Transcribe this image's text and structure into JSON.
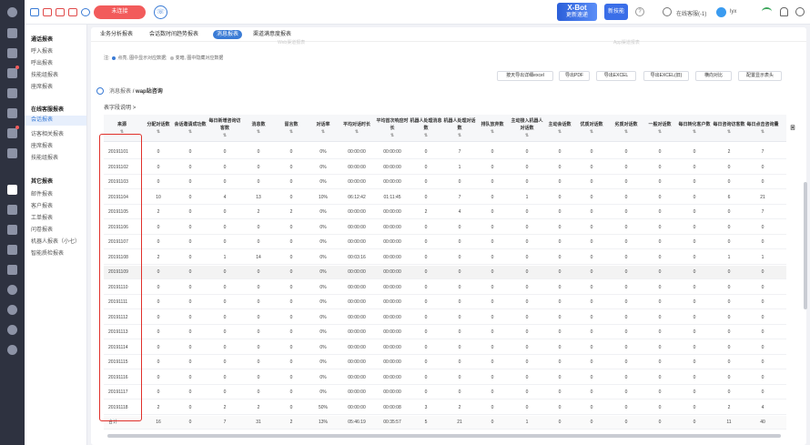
{
  "topbar": {
    "status_label": "未连接",
    "xbot_title": "X-Bot",
    "xbot_sub": "更新速递",
    "new_skill": "新技能",
    "help": "?",
    "online": "在线客服(-1)",
    "user": "lyx"
  },
  "menu": {
    "groups": [
      {
        "title": "通话报表",
        "items": [
          "呼入报表",
          "呼出报表",
          "技能组报表",
          "座席报表"
        ]
      },
      {
        "title": "在线客服报表",
        "items": [
          "会话报表",
          "访客相关报表",
          "座席报表",
          "技能组报表"
        ]
      },
      {
        "title": "其它报表",
        "items": [
          "邮件报表",
          "客户报表",
          "工单报表",
          "问卷报表",
          "机器人报表（小七）",
          "智能质检报表"
        ]
      }
    ]
  },
  "tabs": [
    "业务分析报表",
    "会话数时间趋势报表",
    "消息报表",
    "渠道满意度报表"
  ],
  "ghost": [
    "Web渠道报表",
    "App渠道报表"
  ],
  "note": {
    "prefix": "注:",
    "a": "点亮, 图中显示对应数据;",
    "b": "变暗, 图中隐藏对应数据"
  },
  "buttons": [
    "按天导出详细excel",
    "导出PDF",
    "导出EXCEL",
    "导出EXCEL(旧)",
    "横向对比",
    "配置显示表头"
  ],
  "breadcrumb": {
    "level1": "消息报表",
    "sep": "/",
    "level2": "wap站咨询"
  },
  "field_desc": "表字段说明",
  "field_desc_arrow": ">",
  "columns": [
    "来源",
    "分配对话数",
    "会话邀请成功数",
    "每日新增咨询访客数",
    "消息数",
    "留言数",
    "对话率",
    "平均对话时长",
    "平均首次响应时长",
    "机器人处理消息数",
    "机器人处理对话数",
    "排队放弃数",
    "主动接入机器人对话数",
    "主动会话数",
    "优质对话数",
    "劣质对话数",
    "一般对话数",
    "每日转化客户数",
    "每日咨询访客数",
    "每日点击咨询量",
    "回"
  ],
  "rows": [
    [
      "20191101",
      "0",
      "0",
      "0",
      "0",
      "0",
      "0%",
      "00:00:00",
      "00:00:00",
      "0",
      "7",
      "0",
      "0",
      "0",
      "0",
      "0",
      "0",
      "0",
      "2",
      "7"
    ],
    [
      "20191102",
      "0",
      "0",
      "0",
      "0",
      "0",
      "0%",
      "00:00:00",
      "00:00:00",
      "0",
      "1",
      "0",
      "0",
      "0",
      "0",
      "0",
      "0",
      "0",
      "0",
      "0"
    ],
    [
      "20191103",
      "0",
      "0",
      "0",
      "0",
      "0",
      "0%",
      "00:00:00",
      "00:00:00",
      "0",
      "0",
      "0",
      "0",
      "0",
      "0",
      "0",
      "0",
      "0",
      "0",
      "0"
    ],
    [
      "20191104",
      "10",
      "0",
      "4",
      "13",
      "0",
      "10%",
      "06:12:42",
      "01:11:45",
      "0",
      "7",
      "0",
      "1",
      "0",
      "0",
      "0",
      "0",
      "0",
      "6",
      "21"
    ],
    [
      "20191105",
      "2",
      "0",
      "0",
      "2",
      "2",
      "0%",
      "00:00:00",
      "00:00:00",
      "2",
      "4",
      "0",
      "0",
      "0",
      "0",
      "0",
      "0",
      "0",
      "0",
      "7"
    ],
    [
      "20191106",
      "0",
      "0",
      "0",
      "0",
      "0",
      "0%",
      "00:00:00",
      "00:00:00",
      "0",
      "0",
      "0",
      "0",
      "0",
      "0",
      "0",
      "0",
      "0",
      "0",
      "0"
    ],
    [
      "20191107",
      "0",
      "0",
      "0",
      "0",
      "0",
      "0%",
      "00:00:00",
      "00:00:00",
      "0",
      "0",
      "0",
      "0",
      "0",
      "0",
      "0",
      "0",
      "0",
      "0",
      "0"
    ],
    [
      "20191108",
      "2",
      "0",
      "1",
      "14",
      "0",
      "0%",
      "00:03:16",
      "00:00:00",
      "0",
      "0",
      "0",
      "0",
      "0",
      "0",
      "0",
      "0",
      "0",
      "1",
      "1"
    ],
    [
      "20191109",
      "0",
      "0",
      "0",
      "0",
      "0",
      "0%",
      "00:00:00",
      "00:00:00",
      "0",
      "0",
      "0",
      "0",
      "0",
      "0",
      "0",
      "0",
      "0",
      "0",
      "0"
    ],
    [
      "20191110",
      "0",
      "0",
      "0",
      "0",
      "0",
      "0%",
      "00:00:00",
      "00:00:00",
      "0",
      "0",
      "0",
      "0",
      "0",
      "0",
      "0",
      "0",
      "0",
      "0",
      "0"
    ],
    [
      "20191111",
      "0",
      "0",
      "0",
      "0",
      "0",
      "0%",
      "00:00:00",
      "00:00:00",
      "0",
      "0",
      "0",
      "0",
      "0",
      "0",
      "0",
      "0",
      "0",
      "0",
      "0"
    ],
    [
      "20191112",
      "0",
      "0",
      "0",
      "0",
      "0",
      "0%",
      "00:00:00",
      "00:00:00",
      "0",
      "0",
      "0",
      "0",
      "0",
      "0",
      "0",
      "0",
      "0",
      "0",
      "0"
    ],
    [
      "20191113",
      "0",
      "0",
      "0",
      "0",
      "0",
      "0%",
      "00:00:00",
      "00:00:00",
      "0",
      "0",
      "0",
      "0",
      "0",
      "0",
      "0",
      "0",
      "0",
      "0",
      "0"
    ],
    [
      "20191114",
      "0",
      "0",
      "0",
      "0",
      "0",
      "0%",
      "00:00:00",
      "00:00:00",
      "0",
      "0",
      "0",
      "0",
      "0",
      "0",
      "0",
      "0",
      "0",
      "0",
      "0"
    ],
    [
      "20191115",
      "0",
      "0",
      "0",
      "0",
      "0",
      "0%",
      "00:00:00",
      "00:00:00",
      "0",
      "0",
      "0",
      "0",
      "0",
      "0",
      "0",
      "0",
      "0",
      "0",
      "0"
    ],
    [
      "20191116",
      "0",
      "0",
      "0",
      "0",
      "0",
      "0%",
      "00:00:00",
      "00:00:00",
      "0",
      "0",
      "0",
      "0",
      "0",
      "0",
      "0",
      "0",
      "0",
      "0",
      "0"
    ],
    [
      "20191117",
      "0",
      "0",
      "0",
      "0",
      "0",
      "0%",
      "00:00:00",
      "00:00:00",
      "0",
      "0",
      "0",
      "0",
      "0",
      "0",
      "0",
      "0",
      "0",
      "0",
      "0"
    ],
    [
      "20191118",
      "2",
      "0",
      "2",
      "2",
      "0",
      "50%",
      "00:00:00",
      "00:00:08",
      "3",
      "2",
      "0",
      "0",
      "0",
      "0",
      "0",
      "0",
      "0",
      "2",
      "4"
    ],
    [
      "合计",
      "16",
      "0",
      "7",
      "31",
      "2",
      "13%",
      "05:46:19",
      "00:35:57",
      "5",
      "21",
      "0",
      "1",
      "0",
      "0",
      "0",
      "0",
      "0",
      "11",
      "40"
    ]
  ],
  "colors": {
    "accent": "#3a7bd5",
    "danger": "#f25b5b",
    "highlight_box": "#e0302a"
  },
  "icons": [
    "home-icon",
    "phone-icon",
    "chat-icon",
    "mail-icon",
    "user-icon",
    "ticket-icon",
    "book-icon",
    "report-icon",
    "settings-icon"
  ]
}
